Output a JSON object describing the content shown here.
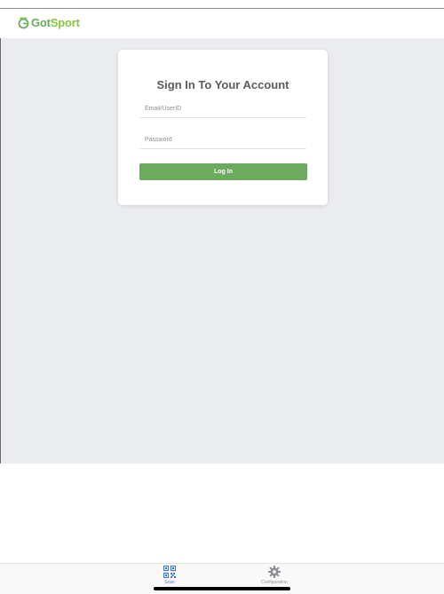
{
  "app": {
    "logo_text_got": "Got",
    "logo_text_sport": "Sport"
  },
  "login": {
    "title": "Sign In To Your Account",
    "email_placeholder": "Email/UserID",
    "email_value": "",
    "password_placeholder": "Password",
    "password_value": "",
    "login_label": "Log In"
  },
  "tabbar": {
    "tabs": [
      {
        "label": "Scan",
        "icon": "qr-code-icon",
        "active": true
      },
      {
        "label": "Configuration",
        "icon": "gear-icon",
        "active": false
      }
    ]
  },
  "colors": {
    "brand_green": "#86c541",
    "button_green": "#6aab5e",
    "background": "#ebecf0",
    "active_tab": "#3e7ae0",
    "inactive_tab": "#8e8e93"
  }
}
